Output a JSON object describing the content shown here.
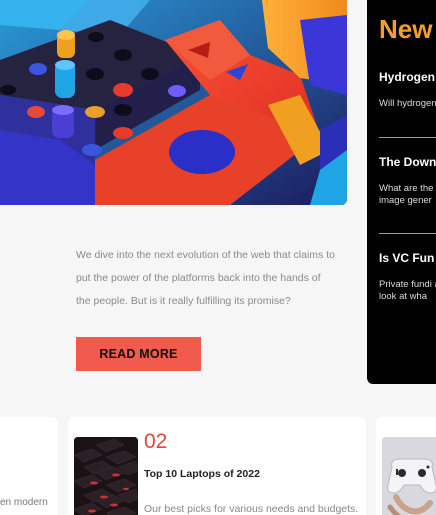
{
  "hero": {
    "image_alt": "Colorful 3D block illustration"
  },
  "intro": {
    "text": "We dive into the next evolution of the web that claims to put the power of the platforms back into the hands of the people. But is it really fulfilling its promise?",
    "read_more_label": "READ MORE"
  },
  "news": {
    "title": "New",
    "items": [
      {
        "heading": "Hydrogen",
        "body": "Will hydrogen"
      },
      {
        "heading": "The Down",
        "body": "What are the image gener"
      },
      {
        "heading": "Is VC Fun",
        "body": "Private fundi a look at wha"
      }
    ],
    "accent_color": "#f59e2a"
  },
  "cards": {
    "left_snippet": "en modern",
    "middle": {
      "number": "02",
      "title": "Top 10 Laptops of 2022",
      "description": "Our best picks for various needs and budgets."
    }
  },
  "colors": {
    "button": "#f25a4d",
    "number": "#e0483d",
    "panel": "#000000"
  }
}
